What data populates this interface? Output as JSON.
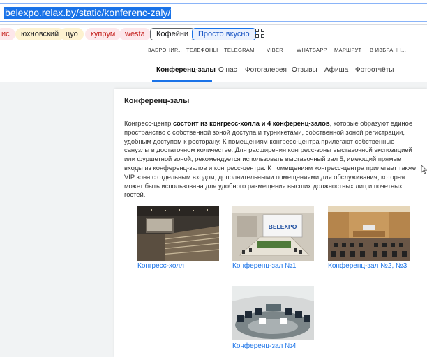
{
  "browser": {
    "url": "belexpo.relax.by/static/konferenc-zaly/"
  },
  "bookmarks": [
    {
      "label": "ис",
      "style": "pink"
    },
    {
      "label": "юхновский",
      "style": "yellow"
    },
    {
      "label": "цуо",
      "style": "yellow"
    },
    {
      "label": "купрум",
      "style": "pink"
    },
    {
      "label": "westa",
      "style": "pink"
    },
    {
      "label": "Кофейни",
      "style": "outline"
    },
    {
      "label": "Просто вкусно",
      "style": "outline-blue"
    }
  ],
  "top_nav": [
    "ЗАБРОНИР...",
    "ТЕЛЕФОНЫ",
    "TELEGRAM",
    "VIBER",
    "WHATSAPP",
    "МАРШРУТ",
    "В ИЗБРАНН..."
  ],
  "main_nav": {
    "items": [
      "Конференц-залы",
      "О нас",
      "Фотогалерея",
      "Отзывы",
      "Афиша",
      "Фотоотчёты"
    ],
    "active_index": 0
  },
  "content": {
    "title": "Конференц-залы",
    "intro_plain_1": "Конгресс-центр ",
    "intro_bold": "состоит из конгресс-холла и 4 конференц-залов",
    "intro_plain_2": ", которые образуют единое пространство с собственной зоной доступа и турникетами, собственной зоной регистрации, удобным доступом к ресторану. К помещениям конгресс-центра прилегают собственные санузлы в достаточном количестве. Для расширения конгресс-зоны выставочной экспозицией или фуршетной зоной, рекомендуется использовать выставочный зал 5, имеющий прямые входы из конференц-залов и конгресс-центра. К помещениям конгресс-центра прилегает также VIP зона с отдельным входом, дополнительными помещениями для обслуживания, которая может быть использована для удобного размещения высших должностных лиц и почетных гостей."
  },
  "halls": [
    {
      "caption": "Конгресс-холл"
    },
    {
      "caption": "Конференц-зал №1",
      "logo_text": "BELEXPO"
    },
    {
      "caption": "Конференц-зал №2, №3"
    },
    {
      "caption": "Конференц-зал №4"
    }
  ],
  "colors": {
    "link": "#1a73e8",
    "url_highlight": "#1a73e8"
  }
}
